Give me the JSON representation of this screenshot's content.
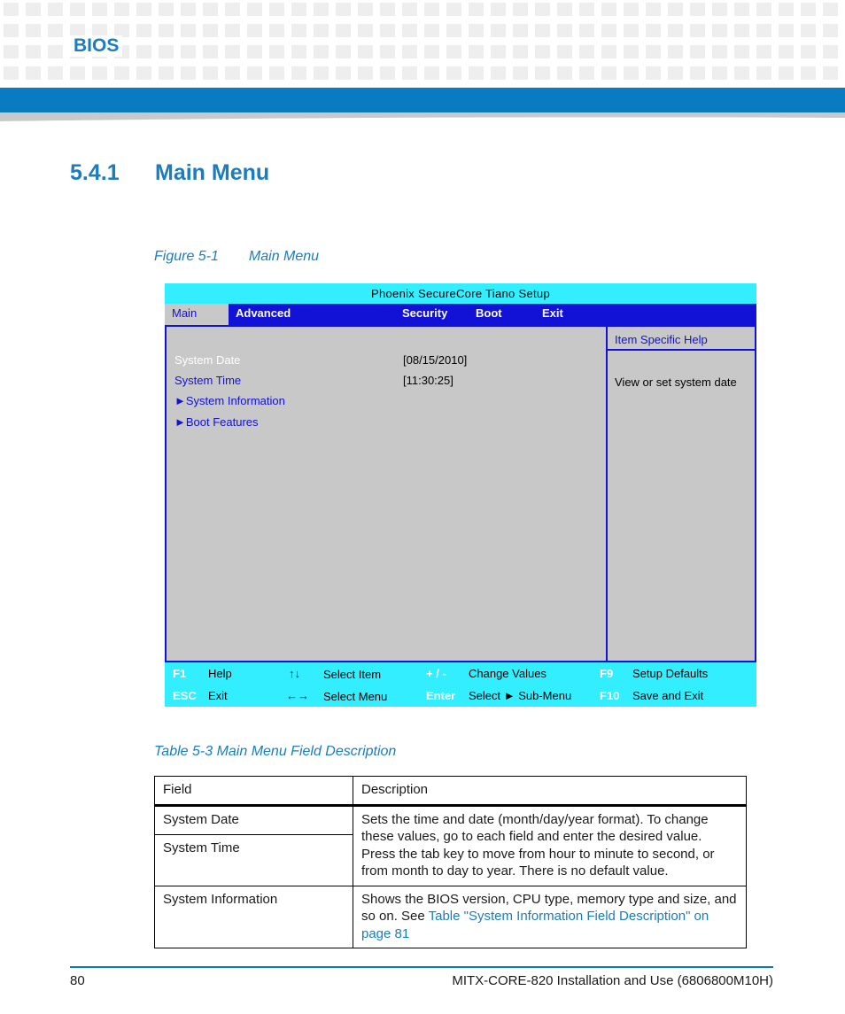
{
  "header": {
    "section": "BIOS"
  },
  "heading": {
    "number": "5.4.1",
    "title": "Main Menu"
  },
  "figure": {
    "label": "Figure 5-1",
    "title": "Main Menu"
  },
  "bios": {
    "title": "Phoenix SecureCore Tiano Setup",
    "menu": [
      "Main",
      "Advanced",
      "Security",
      "Boot",
      "Exit"
    ],
    "fields": [
      {
        "label": "System Date",
        "value": "[08/15/2010]"
      },
      {
        "label": "System Time",
        "value": "[11:30:25]"
      },
      {
        "label": "System Information",
        "value": ""
      },
      {
        "label": "Boot Features",
        "value": ""
      }
    ],
    "help_header": "Item Specific Help",
    "help_text": "View or set system  date",
    "footer": {
      "row1": {
        "k1": "F1",
        "l1": "Help",
        "k2": "↑↓",
        "l2": "Select Item",
        "k3": "+ / -",
        "l3": "Change  Values",
        "k4": "F9",
        "l4": "Setup  Defaults"
      },
      "row2": {
        "k1": "ESC",
        "l1": "Exit",
        "k2": "←→",
        "l2": "Select Menu",
        "k3": "Enter",
        "l3": "Select ► Sub-Menu",
        "k4": "F10",
        "l4": "Save  and  Exit"
      }
    },
    "colors": {
      "cyan": "#33eeff",
      "blue": "#1212d6",
      "grey": "#c8c8c8"
    }
  },
  "table": {
    "caption": "Table 5-3 Main Menu Field Description",
    "headers": [
      "Field",
      "Description"
    ],
    "rows": [
      {
        "field": "System Date",
        "description": "Sets the time and date (month/day/year format). To change these values, go to each field and enter the desired value. Press the tab key to move from hour to minute to second, or from month to day to year. There is no default value."
      },
      {
        "field": "System Time"
      },
      {
        "field": "System Information",
        "description_prefix": "Shows the BIOS version, CPU type, memory type and size, and so on. See ",
        "description_link": "Table \"System Information Field Description\" on page 81"
      }
    ]
  },
  "footer": {
    "page_number": "80",
    "doc_title": "MITX-CORE-820 Installation and Use (6806800M10H)"
  },
  "colors": {
    "accent": "#1a7dc0",
    "band": "#0a7bc1"
  }
}
